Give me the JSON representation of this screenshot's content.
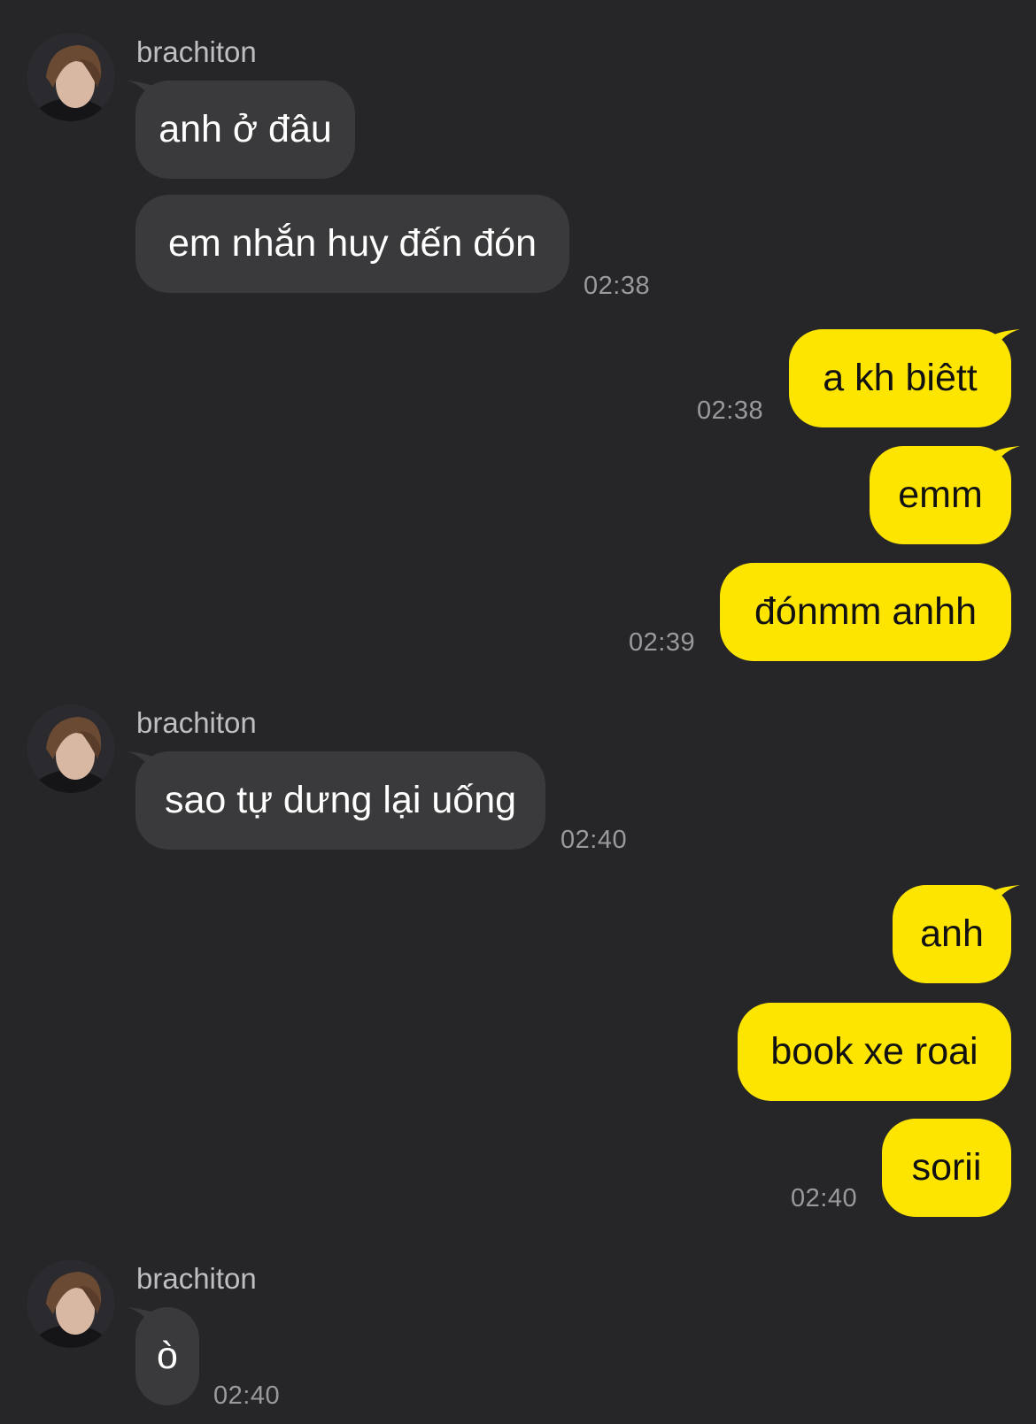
{
  "colors": {
    "background": "#262628",
    "incoming_bubble": "#3a3a3c",
    "outgoing_bubble": "#fee500",
    "timestamp": "#9a9a9e",
    "sender_name": "#bfbfc2"
  },
  "messages": [
    {
      "sender": "brachiton",
      "text": "anh ở đâu"
    },
    {
      "text": "em nhắn huy đến đón",
      "time": "02:38"
    },
    {
      "text": "a kh biêtt",
      "time": "02:38"
    },
    {
      "text": "emm"
    },
    {
      "text": "đónmm anhh",
      "time": "02:39"
    },
    {
      "sender": "brachiton",
      "text": "sao tự dưng lại uống",
      "time": "02:40"
    },
    {
      "text": "anh"
    },
    {
      "text": "book xe roai"
    },
    {
      "text": "sorii",
      "time": "02:40"
    },
    {
      "sender": "brachiton",
      "text": "ò",
      "time": "02:40"
    }
  ]
}
